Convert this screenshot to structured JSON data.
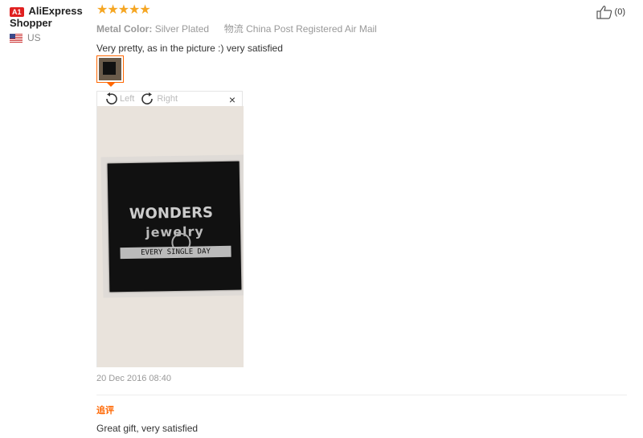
{
  "user": {
    "badge": "A1",
    "name_line1": "AliExpress",
    "name_line2": "Shopper",
    "country": "US",
    "flag_icon": "us-flag-icon"
  },
  "review": {
    "rating_stars": "★★★★★",
    "rating": 5,
    "meta_label": "Metal Color:",
    "meta_value": "Silver Plated",
    "shipping_label": "物流",
    "shipping_value": "China Post Registered Air Mail",
    "text": "Very pretty, as in the picture :) very satisfied",
    "helpful_count": "(0)",
    "date": "20 Dec 2016 08:40"
  },
  "viewer": {
    "rotate_left": "Left",
    "rotate_right": "Right",
    "close": "×",
    "photo_line1": "WONDERS",
    "photo_line2": "jewelry",
    "photo_bar": "EVERY SINGLE DAY"
  },
  "additional": {
    "label": "追评",
    "text": "Great gift, very satisfied"
  },
  "colors": {
    "accent": "#ff6600",
    "star": "#f5a623",
    "badge": "#e02020"
  }
}
